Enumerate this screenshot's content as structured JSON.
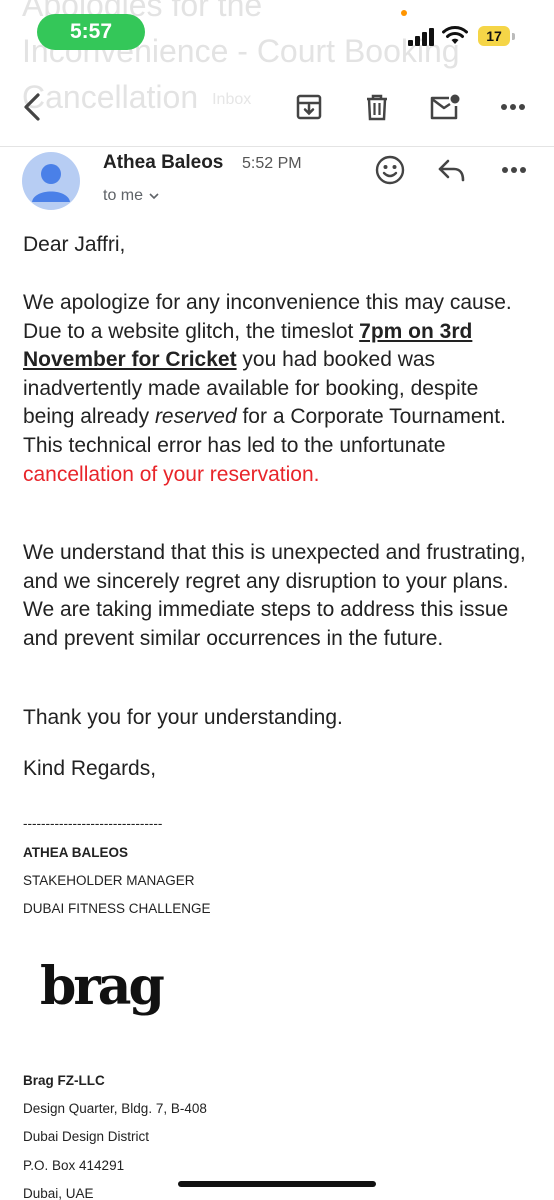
{
  "status_bar": {
    "time": "5:57",
    "battery": "17"
  },
  "subject_ghost": {
    "line1": "Apologies for the",
    "line2": "Inconvenience - Court Booking",
    "line3": "Cancellation",
    "label": "Inbox"
  },
  "toolbar": {
    "back_icon": "back-arrow-icon",
    "archive_icon": "archive-icon",
    "delete_icon": "trash-icon",
    "mark_unread_icon": "mail-unread-icon",
    "more_icon": "more-horizontal-icon"
  },
  "message": {
    "sender": "Athea Baleos",
    "time": "5:52 PM",
    "recipient": "to me",
    "greeting": "Dear Jaffri,",
    "p1_a": "We apologize for any inconvenience this may cause. Due to a website glitch, the timeslot ",
    "p1_link": "7pm on 3rd November for Cricket",
    "p1_b": " you had booked was inadvertently made available for booking, despite being already ",
    "p1_italic": "reserved",
    "p1_c": " for a Corporate Tournament. This technical error has led to the unfortunate ",
    "p1_red": "cancellation of your reservation.",
    "p2": "We understand that this is unexpected and frustrating, and we sincerely regret any disruption to your plans. We are taking immediate steps to address this issue and prevent similar occurrences in the future.",
    "p3": "Thank you for your understanding.",
    "p4": "Kind Regards,"
  },
  "signature": {
    "rule": "-------------------------------",
    "name": "ATHEA BALEOS",
    "title": "STAKEHOLDER MANAGER",
    "org": "DUBAI FITNESS CHALLENGE",
    "logo_text": "brag",
    "company": "Brag FZ-LLC",
    "addr1": "Design Quarter, Bldg. 7, B-408",
    "addr2": "Dubai Design District",
    "addr3": "P.O. Box 414291",
    "addr4": "Dubai, UAE"
  },
  "colors": {
    "red_text": "#e8252a",
    "status_green": "#34c759",
    "avatar_bg": "#b7cdf3",
    "avatar_fg": "#4a80e8"
  }
}
